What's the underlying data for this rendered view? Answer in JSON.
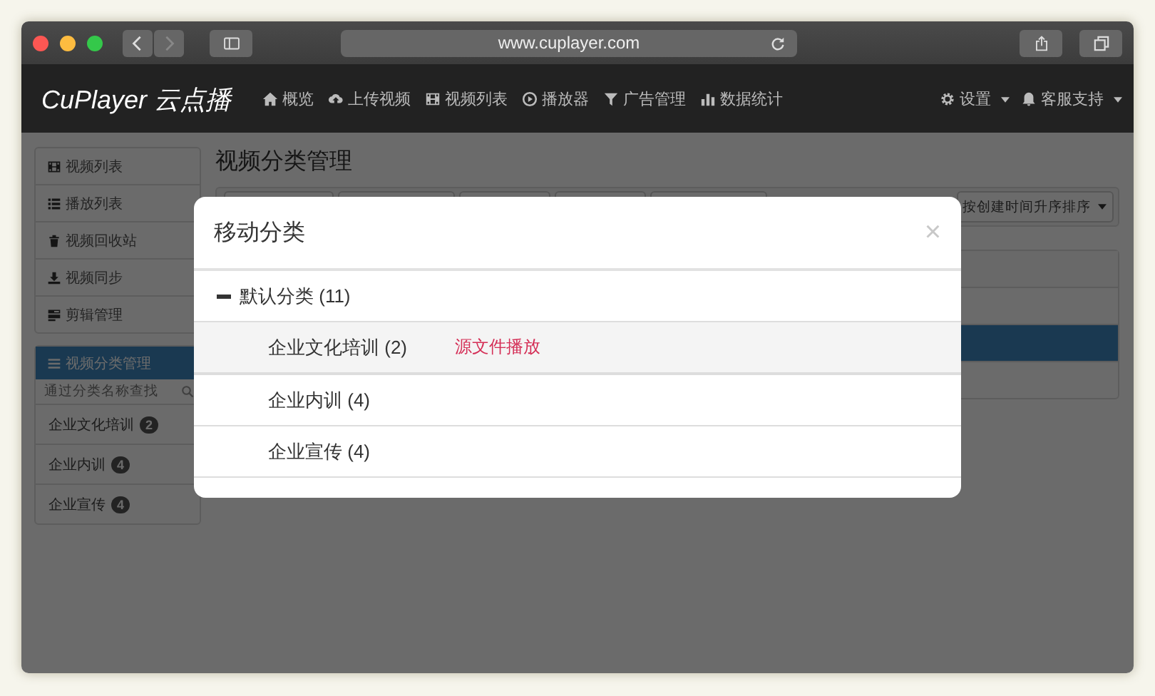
{
  "browser": {
    "url": "www.cuplayer.com"
  },
  "navbar": {
    "brand": "CuPlayer 云点播",
    "items": [
      {
        "label": "概览",
        "kind": "home"
      },
      {
        "label": "上传视频",
        "kind": "upload"
      },
      {
        "label": "视频列表",
        "kind": "film"
      },
      {
        "label": "播放器",
        "kind": "play"
      },
      {
        "label": "广告管理",
        "kind": "filter"
      },
      {
        "label": "数据统计",
        "kind": "chart"
      }
    ],
    "right": [
      {
        "label": "设置",
        "kind": "gear"
      },
      {
        "label": "客服支持",
        "kind": "bell"
      }
    ]
  },
  "sidebar": {
    "menu": [
      {
        "label": "视频列表",
        "kind": "film"
      },
      {
        "label": "播放列表",
        "kind": "list"
      },
      {
        "label": "视频回收站",
        "kind": "trash"
      },
      {
        "label": "视频同步",
        "kind": "sync"
      },
      {
        "label": "剪辑管理",
        "kind": "clip"
      }
    ],
    "category_header": "视频分类管理",
    "search_placeholder": "通过分类名称查找",
    "categories": [
      {
        "name": "企业文化培训",
        "count": "2"
      },
      {
        "name": "企业内训",
        "count": "4"
      },
      {
        "name": "企业宣传",
        "count": "4"
      }
    ]
  },
  "main": {
    "title": "视频分类管理",
    "sort": "按创建时间升序排序",
    "rows": [
      {
        "selected": false
      },
      {
        "selected": true
      },
      {
        "selected": false
      }
    ]
  },
  "modal": {
    "title": "移动分类",
    "close": "×",
    "tree": {
      "label": "默认分类 (11)",
      "expanded": true,
      "children": [
        {
          "label": "企业文化培训 (2)",
          "selected": true,
          "action": "源文件播放"
        },
        {
          "label": "企业内训 (4)",
          "selected": false
        },
        {
          "label": "企业宣传 (4)",
          "selected": false
        }
      ]
    }
  }
}
